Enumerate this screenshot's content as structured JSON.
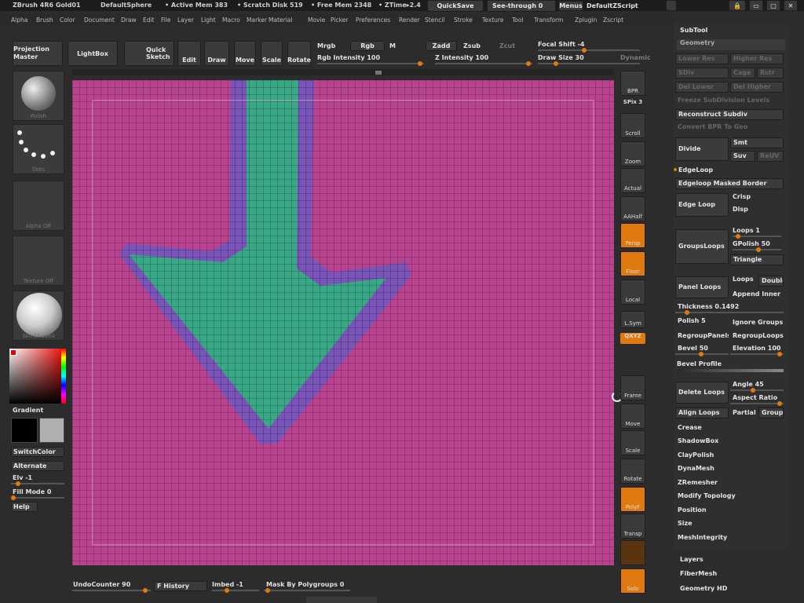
{
  "titlebar": {
    "app": "ZBrush 4R6 Gold01",
    "doc": "DefaultSphere",
    "active_mem": "• Active Mem 383",
    "scratch": "• Scratch Disk 519",
    "free_mem": "• Free Mem 2348",
    "ztime": "• ZTime▸2.4",
    "quicksave": "QuickSave",
    "seethrough": "See-through  0",
    "menus": "Menus",
    "defaultzscript": "DefaultZScript"
  },
  "menubar": [
    "Alpha",
    "Brush",
    "Color",
    "Document",
    "Draw",
    "Edit",
    "File",
    "Layer",
    "Light",
    "Macro",
    "Marker",
    "Material",
    "Movie",
    "Picker",
    "Preferences",
    "Render",
    "Stencil",
    "Stroke",
    "Texture",
    "Tool",
    "Transform",
    "Zplugin",
    "Zscript"
  ],
  "toolbar": {
    "projection_master": "Projection Master",
    "lightbox": "LightBox",
    "quick_sketch": "Quick Sketch",
    "edit": "Edit",
    "draw": "Draw",
    "move": "Move",
    "scale": "Scale",
    "rotate": "Rotate",
    "mrgb": "Mrgb",
    "rgb": "Rgb",
    "m": "M",
    "rgb_intensity": "Rgb Intensity 100",
    "zadd": "Zadd",
    "zsub": "Zsub",
    "zcut": "Zcut",
    "z_intensity": "Z Intensity 100",
    "focal_shift": "Focal Shift -4",
    "draw_size": "Draw Size 30",
    "dynamic": "Dynamic"
  },
  "left_shelf": {
    "brush": "Polish",
    "stroke": "Dots",
    "alpha": "Alpha Off",
    "texture": "Texture Off",
    "material": "SkinShade4",
    "gradient": "Gradient",
    "switchcolor": "SwitchColor",
    "alternate": "Alternate",
    "elv": "Elv -1",
    "fill_mode": "Fill Mode 0",
    "help": "Help"
  },
  "right_tools": [
    {
      "name": "bpr",
      "label": "BPR",
      "active": false
    },
    {
      "name": "spix",
      "label": "SPix 3",
      "active": false
    },
    {
      "name": "scroll",
      "label": "Scroll",
      "active": false
    },
    {
      "name": "zoom",
      "label": "Zoom",
      "active": false
    },
    {
      "name": "actual",
      "label": "Actual",
      "active": false
    },
    {
      "name": "aahalf",
      "label": "AAHalf",
      "active": false
    },
    {
      "name": "persp",
      "label": "Persp",
      "active": true
    },
    {
      "name": "floor",
      "label": "Floor",
      "active": true
    },
    {
      "name": "local",
      "label": "Local",
      "active": false
    },
    {
      "name": "lsym",
      "label": "L.Sym",
      "active": false
    },
    {
      "name": "xyz",
      "label": "QXYZ",
      "active": true
    },
    {
      "name": "frame",
      "label": "Frame",
      "active": false
    },
    {
      "name": "move",
      "label": "Move",
      "active": false
    },
    {
      "name": "scale",
      "label": "Scale",
      "active": false
    },
    {
      "name": "rotate",
      "label": "Rotate",
      "active": false
    },
    {
      "name": "polyf",
      "label": "PolyF",
      "active": true
    },
    {
      "name": "transp",
      "label": "Transp",
      "active": false
    },
    {
      "name": "ghost",
      "label": "",
      "active": false
    },
    {
      "name": "solo",
      "label": "Solo",
      "active": true
    }
  ],
  "right_panel": {
    "subtool": "SubTool",
    "geometry": "Geometry",
    "lower_res": "Lower Res",
    "higher_res": "Higher Res",
    "sdiv": "SDiv",
    "cage": "Cage",
    "rstr": "Rstr",
    "del_lower": "Del Lower",
    "del_higher": "Del Higher",
    "freeze": "Freeze SubDivision Levels",
    "reconstruct": "Reconstruct Subdiv",
    "convert_bpr": "Convert BPR To Geo",
    "divide": "Divide",
    "smt": "Smt",
    "suv": "Suv",
    "reuv": "ReUV",
    "edgeloop_header": "EdgeLoop",
    "edgeloop_masked": "Edgeloop Masked Border",
    "edge_loop": "Edge Loop",
    "crisp": "Crisp",
    "disp": "Disp",
    "groupsloops": "GroupsLoops",
    "loops1": "Loops 1",
    "gpolish": "GPolish 50",
    "triangle": "Triangle",
    "panel_loops": "Panel Loops",
    "loops": "Loops",
    "double": "Double",
    "append_inner": "Append Inner",
    "thickness": "Thickness 0.1492",
    "polish": "Polish 5",
    "ignore_groups": "Ignore Groups",
    "regroup_panels": "RegroupPanels",
    "regroup_loops": "RegroupLoops",
    "bevel": "Bevel 50",
    "elevation": "Elevation 100",
    "bevel_profile": "Bevel Profile",
    "delete_loops": "Delete Loops",
    "angle": "Angle 45",
    "aspect_ratio": "Aspect Ratio",
    "align_loops": "Align Loops",
    "partial": "Partial",
    "groups": "Groups",
    "crease": "Crease",
    "shadowbox": "ShadowBox",
    "claypolish": "ClayPolish",
    "dynamesh": "DynaMesh",
    "zremesher": "ZRemesher",
    "modify_topology": "Modify Topology",
    "position": "Position",
    "size": "Size",
    "meshintegrity": "MeshIntegrity",
    "layers": "Layers",
    "fibermesh": "FiberMesh",
    "geometry_hd": "Geometry HD"
  },
  "bottom": {
    "undo": "UndoCounter 90",
    "history": "F History",
    "imbed": "Imbed -1",
    "mask_polygroups": "Mask By Polygroups 0"
  },
  "colors": {
    "accent": "#e07a10",
    "canvas_magenta": "#b8448f",
    "mesh_green": "#3aa886",
    "border_purple": "#7a55b8"
  }
}
